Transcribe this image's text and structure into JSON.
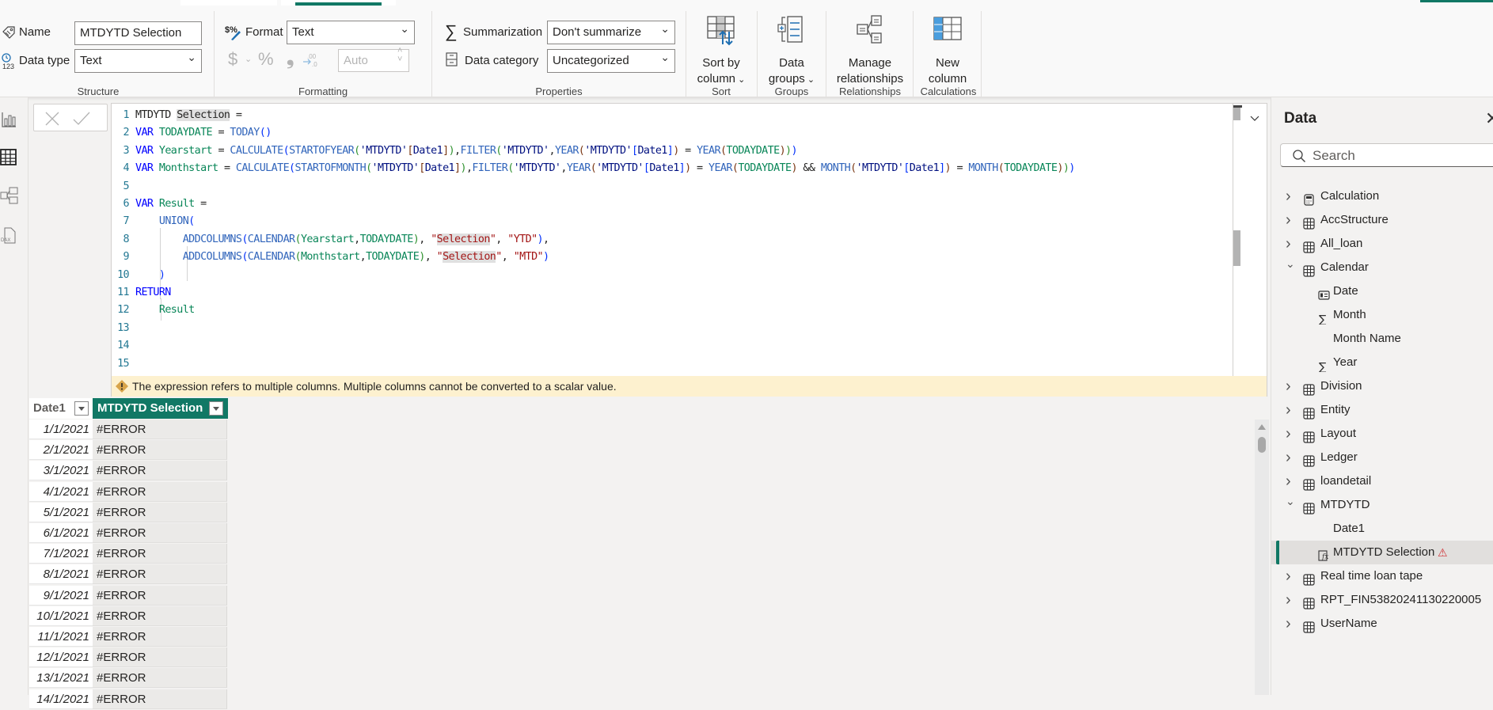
{
  "ribbon": {
    "structure": {
      "name_label": "Name",
      "name_value": "MTDYTD Selection",
      "datatype_label": "Data type",
      "datatype_value": "Text",
      "group_label": "Structure"
    },
    "formatting": {
      "format_label": "Format",
      "format_value": "Text",
      "currency_symbol": "$",
      "percent_symbol": "%",
      "comma_symbol": "❟",
      "decimal_symbol": ".00",
      "decimals_value": "Auto",
      "group_label": "Formatting"
    },
    "properties": {
      "summarization_label": "Summarization",
      "summarization_value": "Don't summarize",
      "datacategory_label": "Data category",
      "datacategory_value": "Uncategorized",
      "group_label": "Properties"
    },
    "sort": {
      "button_line1": "Sort by",
      "button_line2": "column",
      "group_label": "Sort"
    },
    "groups": {
      "button_line1": "Data",
      "button_line2": "groups",
      "group_label": "Groups"
    },
    "relationships": {
      "button_line1": "Manage",
      "button_line2": "relationships",
      "group_label": "Relationships"
    },
    "calculations": {
      "button_line1": "New",
      "button_line2": "column",
      "group_label": "Calculations"
    }
  },
  "left_nav": {
    "items": [
      {
        "name": "report-view",
        "icon": "bar-chart-icon"
      },
      {
        "name": "table-view",
        "icon": "table-icon",
        "active": true
      },
      {
        "name": "model-view",
        "icon": "model-icon"
      },
      {
        "name": "dax-query-view",
        "icon": "dax-icon"
      }
    ]
  },
  "formula_bar": {
    "cancel_icon": "close-icon",
    "commit_icon": "check-icon"
  },
  "editor": {
    "lines": [
      "MTDYTD Selection =",
      "VAR TODAYDATE = TODAY()",
      "VAR Yearstart = CALCULATE(STARTOFYEAR('MTDYTD'[Date1]),FILTER('MTDYTD',YEAR('MTDYTD'[Date1]) = YEAR(TODAYDATE)))",
      "VAR Monthstart = CALCULATE(STARTOFMONTH('MTDYTD'[Date1]),FILTER('MTDYTD',YEAR('MTDYTD'[Date1]) = YEAR(TODAYDATE) && MONTH('MTDYTD'[Date1]) = MONTH(TODAYDATE)))",
      "",
      "VAR Result =",
      "    UNION(",
      "        ADDCOLUMNS(CALENDAR(Yearstart,TODAYDATE), \"Selection\", \"YTD\"),",
      "        ADDCOLUMNS(CALENDAR(Monthstart,TODAYDATE), \"Selection\", \"MTD\")",
      "    )",
      "RETURN",
      "    Result",
      "",
      "",
      ""
    ],
    "line_numbers": [
      "1",
      "2",
      "3",
      "4",
      "5",
      "6",
      "7",
      "8",
      "9",
      "10",
      "11",
      "12",
      "13",
      "14",
      "15"
    ],
    "warning": "The expression refers to multiple columns. Multiple columns cannot be converted to a scalar value."
  },
  "grid": {
    "columns": [
      "Date1",
      "MTDYTD Selection"
    ],
    "rows": [
      [
        "1/1/2021",
        "#ERROR"
      ],
      [
        "2/1/2021",
        "#ERROR"
      ],
      [
        "3/1/2021",
        "#ERROR"
      ],
      [
        "4/1/2021",
        "#ERROR"
      ],
      [
        "5/1/2021",
        "#ERROR"
      ],
      [
        "6/1/2021",
        "#ERROR"
      ],
      [
        "7/1/2021",
        "#ERROR"
      ],
      [
        "8/1/2021",
        "#ERROR"
      ],
      [
        "9/1/2021",
        "#ERROR"
      ],
      [
        "10/1/2021",
        "#ERROR"
      ],
      [
        "11/1/2021",
        "#ERROR"
      ],
      [
        "12/1/2021",
        "#ERROR"
      ],
      [
        "13/1/2021",
        "#ERROR"
      ],
      [
        "14/1/2021",
        "#ERROR"
      ]
    ],
    "selected_column_color": "#117865"
  },
  "data_pane": {
    "title": "Data",
    "search_placeholder": "Search",
    "tree": [
      {
        "label": "Calculation",
        "type": "calc-table",
        "expanded": false,
        "level": 0
      },
      {
        "label": "AccStructure",
        "type": "table",
        "expanded": false,
        "level": 0
      },
      {
        "label": "All_loan",
        "type": "table",
        "expanded": false,
        "level": 0
      },
      {
        "label": "Calendar",
        "type": "table",
        "expanded": true,
        "level": 0
      },
      {
        "label": "Date",
        "type": "date-field",
        "level": 1
      },
      {
        "label": "Month",
        "type": "sum-field",
        "level": 1
      },
      {
        "label": "Month Name",
        "type": "text-field",
        "level": 1
      },
      {
        "label": "Year",
        "type": "sum-field",
        "level": 1
      },
      {
        "label": "Division",
        "type": "table",
        "expanded": false,
        "level": 0
      },
      {
        "label": "Entity",
        "type": "table",
        "expanded": false,
        "level": 0
      },
      {
        "label": "Layout",
        "type": "table",
        "expanded": false,
        "level": 0
      },
      {
        "label": "Ledger",
        "type": "table",
        "expanded": false,
        "level": 0
      },
      {
        "label": "loandetail",
        "type": "table",
        "expanded": false,
        "level": 0
      },
      {
        "label": "MTDYTD",
        "type": "table",
        "expanded": true,
        "level": 0
      },
      {
        "label": "Date1",
        "type": "text-field",
        "level": 1
      },
      {
        "label": "MTDYTD Selection",
        "type": "calc-column",
        "level": 1,
        "selected": true,
        "warning": true
      },
      {
        "label": "Real time loan tape",
        "type": "table",
        "expanded": false,
        "level": 0
      },
      {
        "label": "RPT_FIN53820241130220005",
        "type": "table",
        "expanded": false,
        "level": 0
      },
      {
        "label": "UserName",
        "type": "table",
        "expanded": false,
        "level": 0
      }
    ],
    "accent_color": "#117865",
    "warning_color": "#d13438"
  }
}
